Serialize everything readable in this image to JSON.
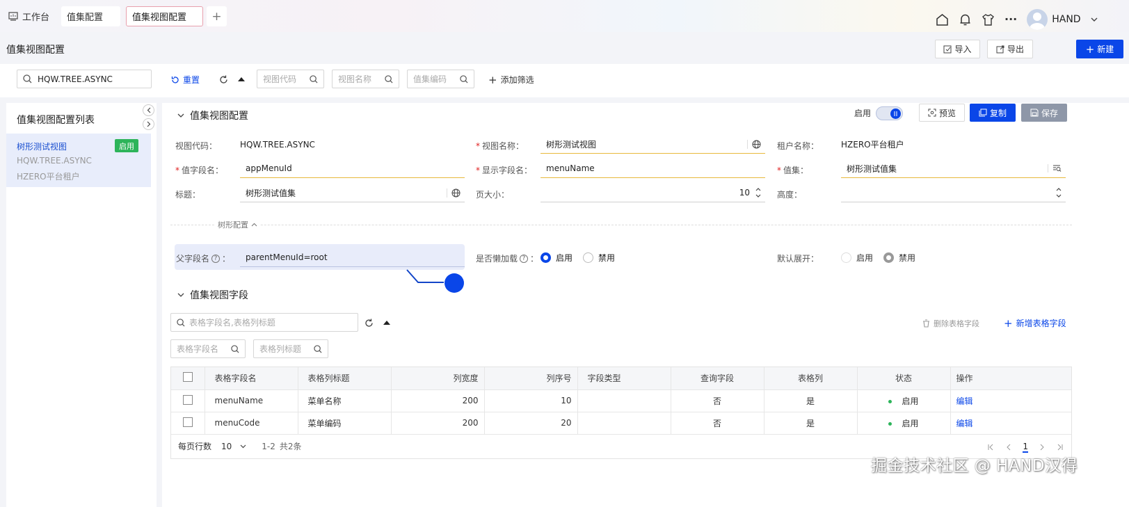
{
  "tabs": {
    "workbench": "工作台",
    "value_set_config": "值集配置",
    "value_set_view_config": "值集视图配置",
    "add": "+"
  },
  "user": {
    "name": "HAND"
  },
  "header": {
    "title": "值集视图配置",
    "import_label": "导入",
    "export_label": "导出",
    "new_label": "新建"
  },
  "filters": {
    "search_value": "HQW.TREE.ASYNC",
    "reset_label": "重置",
    "view_code_placeholder": "视图代码",
    "view_name_placeholder": "视图名称",
    "value_set_code_placeholder": "值集编码",
    "add_filter_label": "添加筛选"
  },
  "list": {
    "title": "值集视图配置列表",
    "items": [
      {
        "name": "树形测试视图",
        "code": "HQW.TREE.ASYNC",
        "tenant": "HZERO平台租户",
        "status": "启用"
      }
    ]
  },
  "config": {
    "section_title": "值集视图配置",
    "enable_label": "启用",
    "preview_label": "预览",
    "copy_label": "复制",
    "save_label": "保存",
    "view_code_label": "视图代码：",
    "view_code": "HQW.TREE.ASYNC",
    "view_name_label": "视图名称：",
    "view_name": "树形测试视图",
    "tenant_label": "租户名称：",
    "tenant": "HZERO平台租户",
    "value_field_label": "值字段名：",
    "value_field": "appMenuId",
    "display_field_label": "显示字段名：",
    "display_field": "menuName",
    "value_set_label": "值集：",
    "value_set": "树形测试值集",
    "title_label": "标题：",
    "title": "树形测试值集",
    "page_size_label": "页大小：",
    "page_size": "10",
    "height_label": "高度：",
    "tree_config_label": "树形配置",
    "parent_field_label": "父字段名",
    "parent_field": "parentMenuId=root",
    "lazy_load_label": "是否懒加载",
    "lazy_enable": "启用",
    "lazy_disable": "禁用",
    "default_expand_label": "默认展开：",
    "expand_enable": "启用",
    "expand_disable": "禁用"
  },
  "fields": {
    "section_title": "值集视图字段",
    "search_placeholder": "表格字段名,表格列标题",
    "delete_label": "删除表格字段",
    "add_label": "新增表格字段",
    "field_name_placeholder": "表格字段名",
    "column_title_placeholder": "表格列标题",
    "columns": [
      "表格字段名",
      "表格列标题",
      "列宽度",
      "列序号",
      "字段类型",
      "查询字段",
      "表格列",
      "状态",
      "操作"
    ],
    "rows": [
      {
        "field": "menuName",
        "title": "菜单名称",
        "width": "200",
        "order": "10",
        "type": "",
        "query": "否",
        "column": "是",
        "status": "启用",
        "action": "编辑"
      },
      {
        "field": "menuCode",
        "title": "菜单编码",
        "width": "200",
        "order": "20",
        "type": "",
        "query": "否",
        "column": "是",
        "status": "启用",
        "action": "编辑"
      }
    ],
    "page_size_label": "每页行数",
    "page_size": "10",
    "range": "1-2",
    "total": "共2条",
    "current_page": "1"
  },
  "watermark": "掘金技术社区 @ HAND汉得",
  "colors": {
    "primary": "#0a46e8",
    "enabled_badge": "#2db45a",
    "status_dot": "#2db45a"
  }
}
